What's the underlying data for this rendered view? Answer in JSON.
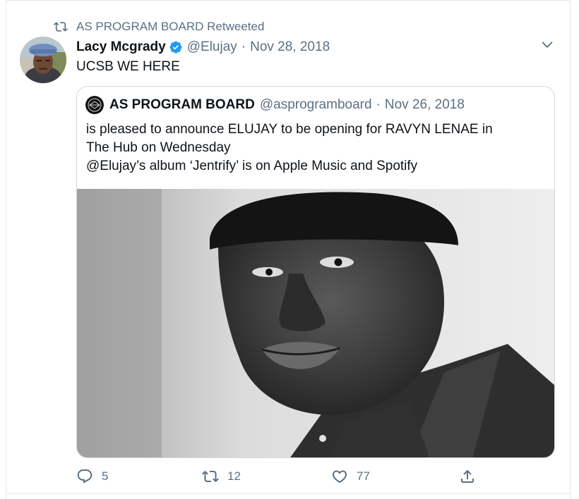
{
  "retweet_context": {
    "label": "AS PROGRAM BOARD Retweeted",
    "icon": "retweet-icon"
  },
  "tweet": {
    "author_name": "Lacy Mcgrady",
    "verified": true,
    "handle": "@Elujay",
    "separator": "·",
    "date": "Nov 28, 2018",
    "text": "UCSB WE HERE",
    "more_icon": "chevron-down-icon"
  },
  "quoted_tweet": {
    "author_name": "AS PROGRAM BOARD",
    "handle": "@asprogramboard",
    "separator": "·",
    "date": "Nov 26, 2018",
    "text_lines": [
      "is pleased to announce ELUJAY to be opening for RAVYN LENAE in",
      "The Hub on Wednesday",
      "@Elujay’s album ‘Jentrify’ is on Apple Music and Spotify"
    ]
  },
  "actions": {
    "reply_count": "5",
    "retweet_count": "12",
    "like_count": "77",
    "icons": [
      "reply-icon",
      "retweet-icon",
      "like-icon",
      "share-icon"
    ]
  },
  "colors": {
    "verified_blue": "#1d9bf0",
    "muted_text": "#5b7083",
    "border": "#cfd9de"
  }
}
